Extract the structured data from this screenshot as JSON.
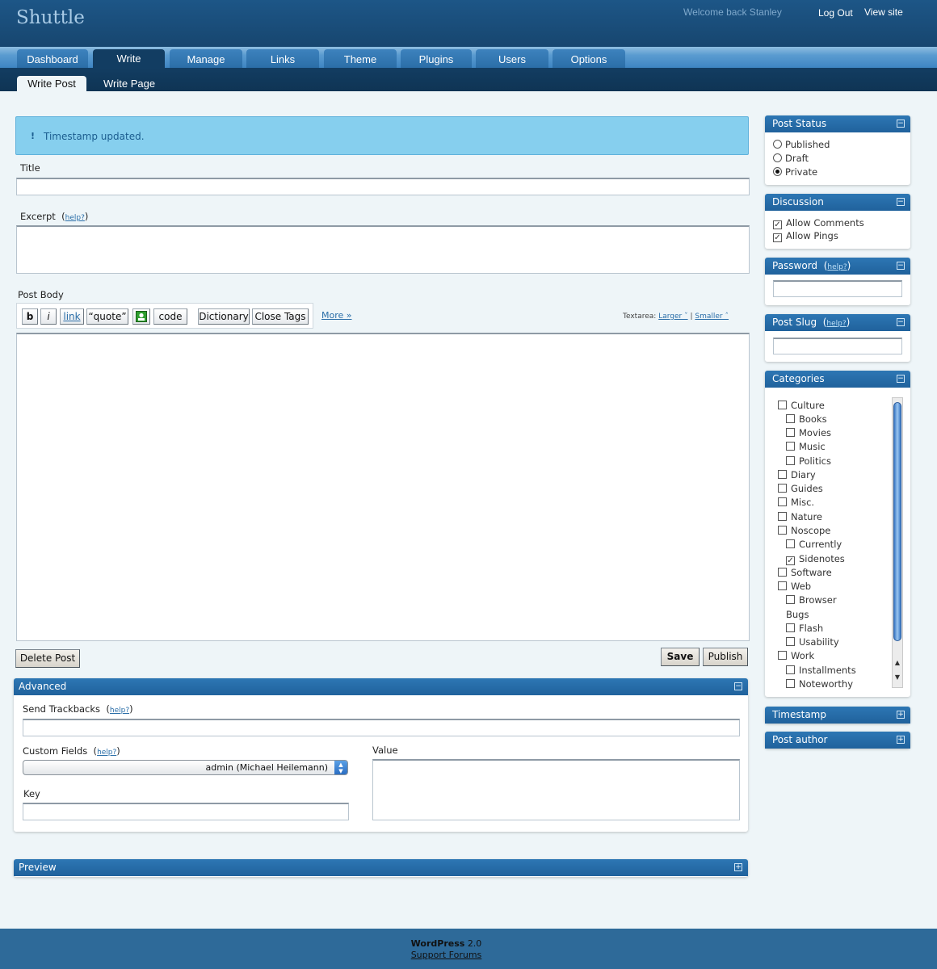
{
  "site": {
    "title": "Shuttle"
  },
  "header": {
    "welcome": "Welcome back Stanley",
    "logout": "Log Out",
    "view_site": "View site"
  },
  "tabs": [
    {
      "label": "Dashboard"
    },
    {
      "label": "Write"
    },
    {
      "label": "Manage"
    },
    {
      "label": "Links"
    },
    {
      "label": "Theme"
    },
    {
      "label": "Plugins"
    },
    {
      "label": "Users"
    },
    {
      "label": "Options"
    }
  ],
  "subtabs": [
    {
      "label": "Write Post"
    },
    {
      "label": "Write Page"
    }
  ],
  "notice": {
    "icon": "!",
    "text": "Timestamp updated."
  },
  "form": {
    "title_label": "Title",
    "excerpt_label": "Excerpt",
    "help": "help?",
    "body_label": "Post Body",
    "more_link": "More »",
    "textarea_label": "Textarea:",
    "larger": "Larger ˇ",
    "separator": "|",
    "smaller": "Smaller ˆ",
    "delete_button": "Delete Post",
    "save_button": "Save",
    "publish_button": "Publish"
  },
  "quicktags": {
    "bold": "b",
    "italic": "i",
    "link": "link",
    "quote": "“quote”",
    "code": "code",
    "dictionary": "Dictionary",
    "close_tags": "Close Tags"
  },
  "advanced": {
    "title": "Advanced",
    "trackbacks_label": "Send Trackbacks",
    "custom_fields_label": "Custom Fields",
    "selected_author": "admin (Michael Heilemann)",
    "key_label": "Key",
    "value_label": "Value"
  },
  "preview": {
    "title": "Preview"
  },
  "sidebar": {
    "post_status": {
      "title": "Post Status",
      "options": [
        "Published",
        "Draft",
        "Private"
      ],
      "selected": "Private"
    },
    "discussion": {
      "title": "Discussion",
      "options": [
        {
          "label": "Allow Comments",
          "checked": true
        },
        {
          "label": "Allow Pings",
          "checked": true
        }
      ]
    },
    "password": {
      "title": "Password"
    },
    "post_slug": {
      "title": "Post Slug"
    },
    "categories": {
      "title": "Categories",
      "items": [
        {
          "label": "Culture",
          "checked": false
        },
        {
          "label": "Books",
          "checked": false
        },
        {
          "label": "Movies",
          "checked": false
        },
        {
          "label": "Music",
          "checked": false
        },
        {
          "label": "Politics",
          "checked": false
        },
        {
          "label": "Diary",
          "checked": false
        },
        {
          "label": "Guides",
          "checked": false
        },
        {
          "label": "Misc.",
          "checked": false
        },
        {
          "label": "Nature",
          "checked": false
        },
        {
          "label": "Noscope",
          "checked": false
        },
        {
          "label": "Currently",
          "checked": false
        },
        {
          "label": "Sidenotes",
          "checked": true
        },
        {
          "label": "Software",
          "checked": false
        },
        {
          "label": "Web",
          "checked": false
        },
        {
          "label": "Browser",
          "checked": false
        },
        {
          "label": "Bugs",
          "checked": false
        },
        {
          "label": "Flash",
          "checked": false
        },
        {
          "label": "Usability",
          "checked": false
        },
        {
          "label": "Work",
          "checked": false
        },
        {
          "label": "Installments",
          "checked": false
        },
        {
          "label": "Noteworthy",
          "checked": false
        }
      ]
    },
    "timestamp": {
      "title": "Timestamp"
    },
    "post_author": {
      "title": "Post author"
    }
  },
  "panel_toggles": {
    "collapse": "−",
    "expand": "+"
  },
  "footer": {
    "product": "WordPress",
    "version": "2.0",
    "forums": "Support Forums"
  }
}
